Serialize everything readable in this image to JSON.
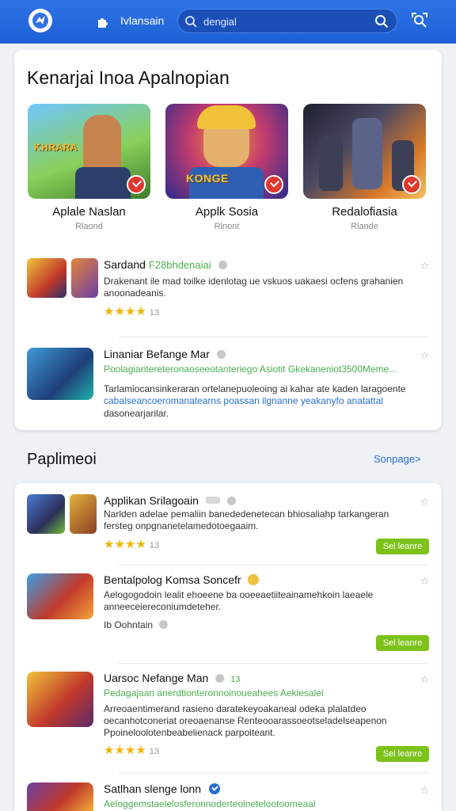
{
  "header": {
    "nav_label": "Ivlansain",
    "search_text": "dengial",
    "colors": {
      "bar": "#1e5fd6",
      "search": "#1a4fb8"
    }
  },
  "featured": {
    "title": "Kenarjai Inoa Apalnopian",
    "cards": [
      {
        "name": "Aplale Naslan",
        "sub": "Rlaond",
        "thumb_text": "KHRARA"
      },
      {
        "name": "Applk Sosia",
        "sub": "Rlnont",
        "thumb_text": "KONGE"
      },
      {
        "name": "Redalofiasia",
        "sub": "Rlande",
        "thumb_text": ""
      }
    ],
    "items": [
      {
        "title": "Sardand",
        "title_green": "F28bhdenaiai",
        "desc": "Drakenant ile mad toilke idenlotag ue vskuos uakaesi ocfens grahanien anoonadeanis.",
        "rating": "★★★★",
        "rating_count": "13"
      },
      {
        "title": "Linaniar Befange Mar",
        "desc_green": "Poolagiaritereteronaoseeotanteriego Asiotit Gkekaneniot3500Meme...",
        "desc": "Tarlamiocansinkeraran ortelanepuoleoing ai kahar ate kaden laragoente",
        "desc_blue": "cabalseancoeromanatearns poassan ilgnanne yeakanyfo anatattal",
        "desc_tail": "dasonearjarilar."
      }
    ]
  },
  "section2": {
    "title": "Paplimeoi",
    "link": "Sonpage>",
    "get_label": "Sel leanre",
    "items": [
      {
        "title": "Applikan Srilagoain",
        "desc": "Narlden adelae pemaliin banededenetecan bhiosaliahp tarkangeran fersteg onpgnanetelamedotoegaaim.",
        "rating": "★★★★",
        "rating_count": "13"
      },
      {
        "title": "Bentalpolog Komsa Soncefr",
        "desc": "Aelogogodoin lealit ehoeene ba ooeeaetiiteainamehkoin laeaele anneeceiereconiumdeteher.",
        "meta": "Ib Oohntain"
      },
      {
        "title": "Uarsoc Nefange Man",
        "title_num": "13",
        "desc_green": "Pedagajaan anerdtionteronnoinoueahees Aekiesalel",
        "desc": "Arreoaentimerand rasieno daratekeyoakaneal odeka plalatdeo oecanhotconeriat oreoaenanse Renteooarassoeotseladelseapenon Ppoineloolotenbeabelienack parpoiteant.",
        "rating": "★★★★",
        "rating_count": "13"
      },
      {
        "title": "Satlhan slenge lonn",
        "desc_green": "Aeloggemstaelelosferonnoderteolnetelootoomeaal"
      }
    ]
  }
}
